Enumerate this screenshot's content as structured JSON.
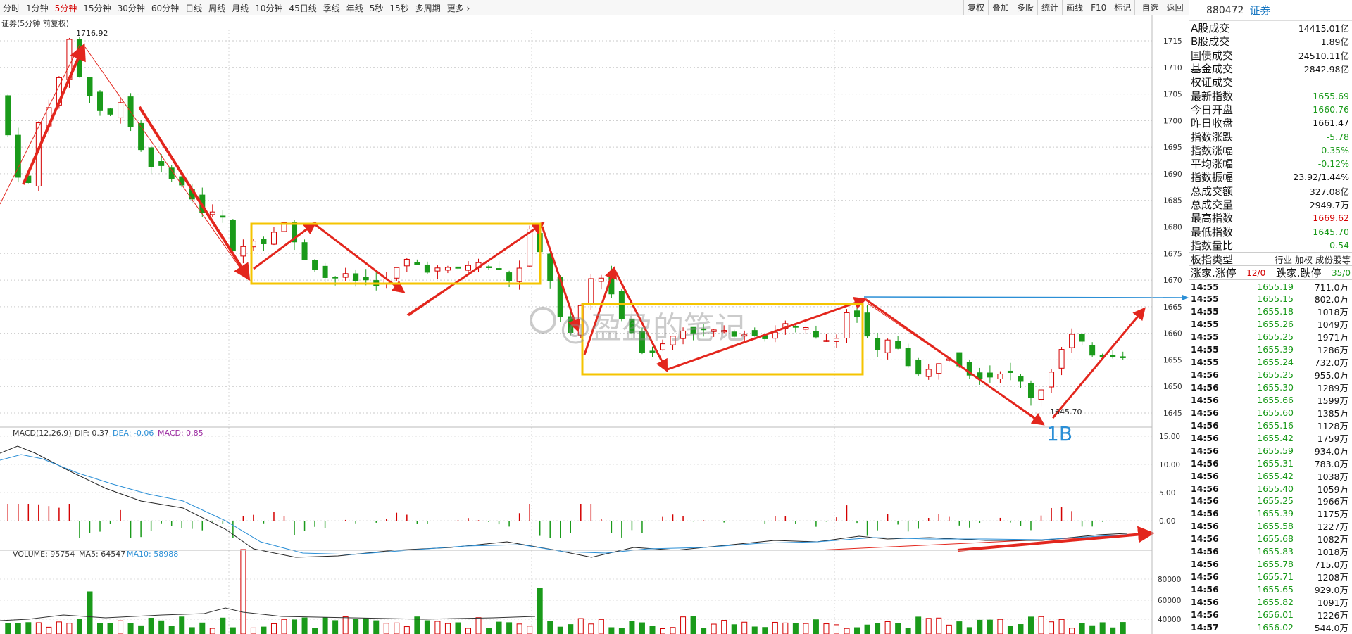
{
  "timeframes": [
    {
      "label": "分时",
      "active": false
    },
    {
      "label": "1分钟",
      "active": false
    },
    {
      "label": "5分钟",
      "active": true
    },
    {
      "label": "15分钟",
      "active": false
    },
    {
      "label": "30分钟",
      "active": false
    },
    {
      "label": "60分钟",
      "active": false
    },
    {
      "label": "日线",
      "active": false
    },
    {
      "label": "周线",
      "active": false
    },
    {
      "label": "月线",
      "active": false
    },
    {
      "label": "10分钟",
      "active": false
    },
    {
      "label": "45日线",
      "active": false
    },
    {
      "label": "季线",
      "active": false
    },
    {
      "label": "年线",
      "active": false
    },
    {
      "label": "5秒",
      "active": false
    },
    {
      "label": "15秒",
      "active": false
    },
    {
      "label": "多周期",
      "active": false
    },
    {
      "label": "更多 ›",
      "active": false
    }
  ],
  "tools": [
    "复权",
    "叠加",
    "多股",
    "统计",
    "画线",
    "F10",
    "标记",
    "-自选",
    "返回"
  ],
  "main_title": "证券(5分钟 前复权)",
  "high_label": "1716.92",
  "low_label": "1645.70",
  "annotation_1b": "1B",
  "watermark": "@盈盈的笔记",
  "price_axis": [
    "1715",
    "1710",
    "1705",
    "1700",
    "1695",
    "1690",
    "1685",
    "1680",
    "1675",
    "1670",
    "1665",
    "1660",
    "1655",
    "1650",
    "1645"
  ],
  "macd": {
    "label": "MACD(12,26,9)",
    "dif": "DIF: 0.37",
    "dea": "DEA: -0.06",
    "macd": "MACD: 0.85",
    "axis": [
      "15.00",
      "10.00",
      "5.00",
      "0.00"
    ]
  },
  "volume": {
    "label": "VOLUME: 95754",
    "ma5": "MA5: 64547",
    "ma10": "MA10: 58988",
    "axis": [
      "80000",
      "60000",
      "40000"
    ]
  },
  "right_panel": {
    "code": "880472",
    "name": "证券",
    "stats": [
      {
        "label": "A股成交",
        "value": "14415.01亿",
        "color": ""
      },
      {
        "label": "B股成交",
        "value": "1.89亿",
        "color": ""
      },
      {
        "label": "国债成交",
        "value": "24510.11亿",
        "color": ""
      },
      {
        "label": "基金成交",
        "value": "2842.98亿",
        "color": ""
      },
      {
        "label": "权证成交",
        "value": "",
        "color": ""
      },
      {
        "label": "最新指数",
        "value": "1655.69",
        "color": "g"
      },
      {
        "label": "今日开盘",
        "value": "1660.76",
        "color": "g"
      },
      {
        "label": "昨日收盘",
        "value": "1661.47",
        "color": ""
      },
      {
        "label": "指数涨跌",
        "value": "-5.78",
        "color": "g"
      },
      {
        "label": "指数涨幅",
        "value": "-0.35%",
        "color": "g"
      },
      {
        "label": "平均涨幅",
        "value": "-0.12%",
        "color": "g"
      },
      {
        "label": "指数振幅",
        "value": "23.92/1.44%",
        "color": ""
      },
      {
        "label": "总成交额",
        "value": "327.08亿",
        "color": ""
      },
      {
        "label": "总成交量",
        "value": "2949.7万",
        "color": ""
      },
      {
        "label": "最高指数",
        "value": "1669.62",
        "color": "r"
      },
      {
        "label": "最低指数",
        "value": "1645.70",
        "color": "g"
      },
      {
        "label": "指数量比",
        "value": "0.54",
        "color": "g"
      }
    ],
    "board": {
      "label": "板指类型",
      "value": "行业 加权 成份股等"
    },
    "zhangting": {
      "up_label": "涨家.涨停",
      "up_value": "12/0",
      "down_label": "跌家.跌停",
      "down_value": "35/0"
    },
    "ticks": [
      {
        "t": "14:55",
        "p": "1655.19",
        "v": "711.0万"
      },
      {
        "t": "14:55",
        "p": "1655.15",
        "v": "802.0万"
      },
      {
        "t": "14:55",
        "p": "1655.18",
        "v": "1018万"
      },
      {
        "t": "14:55",
        "p": "1655.26",
        "v": "1049万"
      },
      {
        "t": "14:55",
        "p": "1655.25",
        "v": "1971万"
      },
      {
        "t": "14:55",
        "p": "1655.39",
        "v": "1286万"
      },
      {
        "t": "14:55",
        "p": "1655.24",
        "v": "732.0万"
      },
      {
        "t": "14:56",
        "p": "1655.25",
        "v": "955.0万"
      },
      {
        "t": "14:56",
        "p": "1655.30",
        "v": "1289万"
      },
      {
        "t": "14:56",
        "p": "1655.66",
        "v": "1599万"
      },
      {
        "t": "14:56",
        "p": "1655.60",
        "v": "1385万"
      },
      {
        "t": "14:56",
        "p": "1655.16",
        "v": "1128万"
      },
      {
        "t": "14:56",
        "p": "1655.42",
        "v": "1759万"
      },
      {
        "t": "14:56",
        "p": "1655.59",
        "v": "934.0万"
      },
      {
        "t": "14:56",
        "p": "1655.31",
        "v": "783.0万"
      },
      {
        "t": "14:56",
        "p": "1655.42",
        "v": "1038万"
      },
      {
        "t": "14:56",
        "p": "1655.40",
        "v": "1059万"
      },
      {
        "t": "14:56",
        "p": "1655.25",
        "v": "1966万"
      },
      {
        "t": "14:56",
        "p": "1655.39",
        "v": "1175万"
      },
      {
        "t": "14:56",
        "p": "1655.58",
        "v": "1227万"
      },
      {
        "t": "14:56",
        "p": "1655.68",
        "v": "1082万"
      },
      {
        "t": "14:56",
        "p": "1655.83",
        "v": "1018万"
      },
      {
        "t": "14:56",
        "p": "1655.78",
        "v": "715.0万"
      },
      {
        "t": "14:56",
        "p": "1655.71",
        "v": "1208万"
      },
      {
        "t": "14:56",
        "p": "1655.65",
        "v": "929.0万"
      },
      {
        "t": "14:56",
        "p": "1655.82",
        "v": "1091万"
      },
      {
        "t": "14:56",
        "p": "1656.01",
        "v": "1226万"
      },
      {
        "t": "14:57",
        "p": "1656.02",
        "v": "544.0万"
      }
    ]
  },
  "colors": {
    "up": "#d40000",
    "down": "#1a9a1a",
    "arrow": "#e3261d",
    "box": "#f5c400",
    "blue": "#2b8fd6"
  }
}
